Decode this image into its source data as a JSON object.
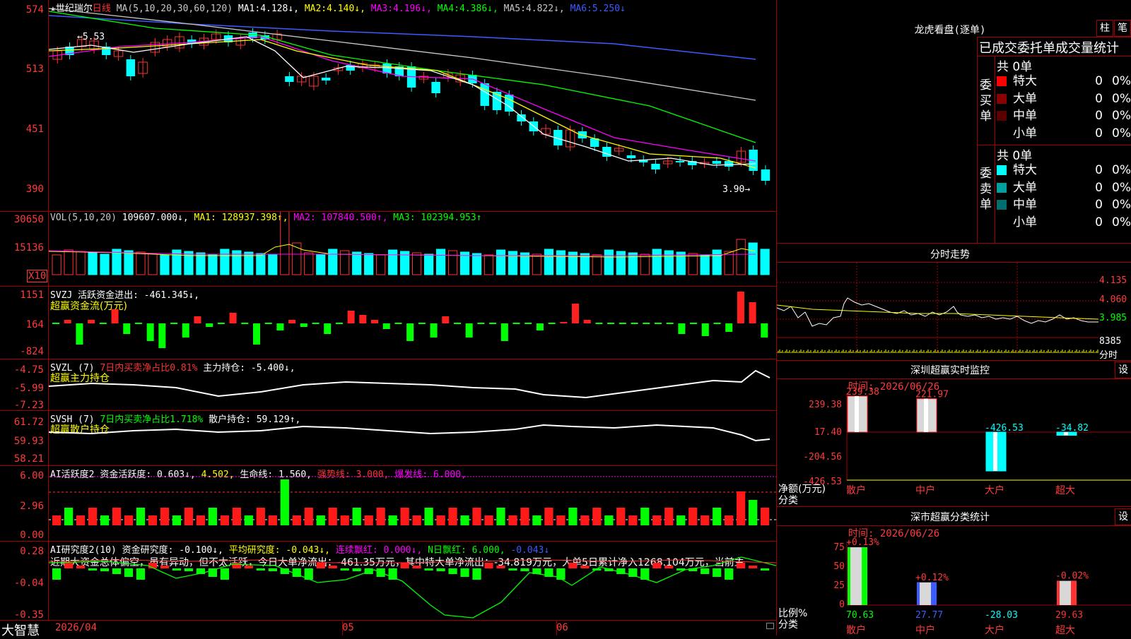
{
  "stock": {
    "star": "★",
    "name": "世纪瑞尔",
    "period": "日线"
  },
  "ma_line": {
    "label": "MA(5,10,20,30,60,120)",
    "items": [
      {
        "name": "MA1:",
        "value": "4.128↓,",
        "color": "#ffffff"
      },
      {
        "name": "MA2:",
        "value": "4.140↓,",
        "color": "#ffff00"
      },
      {
        "name": "MA3:",
        "value": "4.196↓,",
        "color": "#ff00ff"
      },
      {
        "name": "MA4:",
        "value": "4.386↓,",
        "color": "#00ff00"
      },
      {
        "name": "MA5:",
        "value": "4.822↓,",
        "color": "#c8c8c8"
      },
      {
        "name": "MA6:",
        "value": "5.250↓",
        "color": "#3d5cff"
      }
    ]
  },
  "price_axis": [
    "574",
    "513",
    "451",
    "390"
  ],
  "price_annotations": {
    "high": "5.53",
    "low": "3.90"
  },
  "vol_panel": {
    "label": "VOL(5,10,20)",
    "value": "109607.000↓,",
    "ma1": "MA1: 128937.398↑,",
    "ma2": "MA2: 107840.500↑,",
    "ma3": "MA3: 102394.953↑",
    "axis": [
      "30650",
      "15136"
    ],
    "unit": "X10"
  },
  "svzj_panel": {
    "label": "SVZJ  活跃资金进出: -461.345↓,",
    "sub": "超赢资金流(万元)",
    "axis": [
      "1151",
      "164",
      "-824"
    ]
  },
  "svzl_panel": {
    "label": "SVZL (7)",
    "desc": "7日内买卖净占比0.81%",
    "main": "主力持仓: -5.400↓,",
    "sub": "超赢主力持仓",
    "axis": [
      "-4.75",
      "-5.99",
      "-7.23"
    ]
  },
  "svsh_panel": {
    "label": "SVSH (7)",
    "desc": "7日内买卖净占比1.718%",
    "main": "散户持仓: 59.129↑,",
    "sub": "超赢散户持仓",
    "axis": [
      "61.72",
      "59.93",
      "58.21"
    ]
  },
  "ai_active": {
    "label": "AI活跃度2",
    "t1": "资金活跃度: 0.603↓,",
    "t2": "4.502,",
    "t3": "生命线: 1.560,",
    "t4": "强势线: 3.000,",
    "t5": "爆发线: 6.000,",
    "axis": [
      "6.00",
      "2.96",
      "0.00"
    ]
  },
  "ai_research": {
    "label": "AI研究度2(10)",
    "t1": "资金研究度: -0.100↓,",
    "t2": "平均研究度: -0.043↓,",
    "t3": "连续飘红: 0.000↓,",
    "t4": "N日飘红: 6.000,",
    "t5": "-0.043↓",
    "axis": [
      "0.28",
      "-0.04",
      "-0.35"
    ],
    "comment": "近期大资金总体偏空，虽有异动，但不太活跃，今日大单净流出：-461.35万元，其中特大单净流出：-34.819万元，大单5日累计净入1268.104万元，当前主"
  },
  "xaxis": {
    "brand": "大智慧",
    "date": "2026/04",
    "m05": "05",
    "m06": "06"
  },
  "longhu": {
    "title": "龙虎看盘(逐单)",
    "btn1": "柱",
    "btn2": "笔",
    "header": "已成交委托单成交量统计",
    "buy": {
      "side": "委买单",
      "total": "共 0单",
      "rows": [
        {
          "label": "特大",
          "count": "0",
          "pct": "0%",
          "color": "#ff0000"
        },
        {
          "label": "大单",
          "count": "0",
          "pct": "0%",
          "color": "#8b0000"
        },
        {
          "label": "中单",
          "count": "0",
          "pct": "0%",
          "color": "#5a0000"
        },
        {
          "label": "小单",
          "count": "0",
          "pct": "0%",
          "color": "#000000"
        }
      ]
    },
    "sell": {
      "side": "委卖单",
      "total": "共 0单",
      "rows": [
        {
          "label": "特大",
          "count": "0",
          "pct": "0%",
          "color": "#00ffff"
        },
        {
          "label": "大单",
          "count": "0",
          "pct": "0%",
          "color": "#00a0a0"
        },
        {
          "label": "中单",
          "count": "0",
          "pct": "0%",
          "color": "#006e6e"
        },
        {
          "label": "小单",
          "count": "0",
          "pct": "0%",
          "color": "#000000"
        }
      ]
    }
  },
  "intraday": {
    "title": "分时走势",
    "axis": [
      "4.135",
      "4.060",
      "3.985"
    ],
    "vol": "8385",
    "vol_label": "分时"
  },
  "sz_monitor": {
    "title": "深圳超赢实时监控",
    "btn": "设",
    "time": "时间: 2026/06/26",
    "axis": [
      "239.38",
      "17.40",
      "-204.56",
      "-426.53"
    ],
    "ylabel": "净额(万元)",
    "xlabel": "分类",
    "categories": [
      "散户",
      "中户",
      "大户",
      "超大"
    ],
    "values": [
      "239.38",
      "221.97",
      "-426.53",
      "-34.82"
    ]
  },
  "sz_stats": {
    "title": "深市超赢分类统计",
    "btn": "设",
    "time": "时间: 2026/06/26",
    "axis": [
      "75",
      "50",
      "25",
      "0"
    ],
    "ylabel": "比例%",
    "xlabel": "分类",
    "categories": [
      "散户",
      "中户",
      "大户",
      "超大"
    ],
    "top_labels": [
      "+0.13%",
      "+0.12%",
      "",
      "-0.02%"
    ],
    "values": [
      "70.63",
      "27.77",
      "-28.03",
      "29.63"
    ]
  },
  "chart_data": [
    {
      "type": "bar",
      "title": "深圳超赢实时监控",
      "ylabel": "净额(万元)",
      "xlabel": "分类",
      "categories": [
        "散户",
        "中户",
        "大户",
        "超大"
      ],
      "values": [
        239.38,
        221.97,
        -426.53,
        -34.82
      ],
      "ylim": [
        -426.53,
        239.38
      ]
    },
    {
      "type": "bar",
      "title": "深市超赢分类统计",
      "ylabel": "比例%",
      "xlabel": "分类",
      "categories": [
        "散户",
        "中户",
        "大户",
        "超大"
      ],
      "values": [
        70.63,
        27.77,
        -28.03,
        29.63
      ],
      "ylim": [
        0,
        75
      ]
    }
  ]
}
